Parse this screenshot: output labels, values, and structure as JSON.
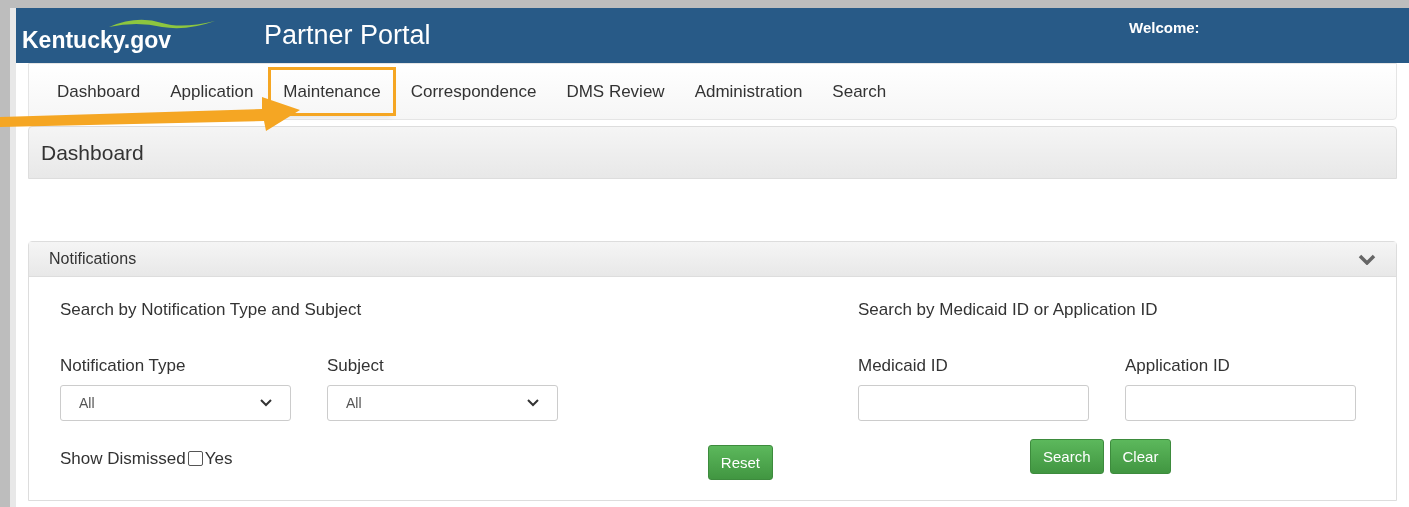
{
  "header": {
    "logo": "Kentucky.gov",
    "title": "Partner Portal",
    "welcome": "Welcome:"
  },
  "nav": [
    {
      "label": "Dashboard",
      "highlighted": false
    },
    {
      "label": "Application",
      "highlighted": false
    },
    {
      "label": "Maintenance",
      "highlighted": true
    },
    {
      "label": "Correspondence",
      "highlighted": false
    },
    {
      "label": "DMS Review",
      "highlighted": false
    },
    {
      "label": "Administration",
      "highlighted": false
    },
    {
      "label": "Search",
      "highlighted": false
    }
  ],
  "page_title": "Dashboard",
  "notifications": {
    "title": "Notifications",
    "expanded": true,
    "left": {
      "heading": "Search by Notification Type and Subject",
      "fields": [
        {
          "label": "Notification Type",
          "value": "All"
        },
        {
          "label": "Subject",
          "value": "All"
        }
      ],
      "show_dismissed": {
        "label": "Show Dismissed",
        "option": "Yes",
        "checked": false
      },
      "buttons": [
        "Reset"
      ]
    },
    "right": {
      "heading": "Search by Medicaid ID or Application ID",
      "fields": [
        {
          "label": "Medicaid ID"
        },
        {
          "label": "Application ID"
        }
      ],
      "buttons": [
        "Search",
        "Clear"
      ]
    }
  }
}
